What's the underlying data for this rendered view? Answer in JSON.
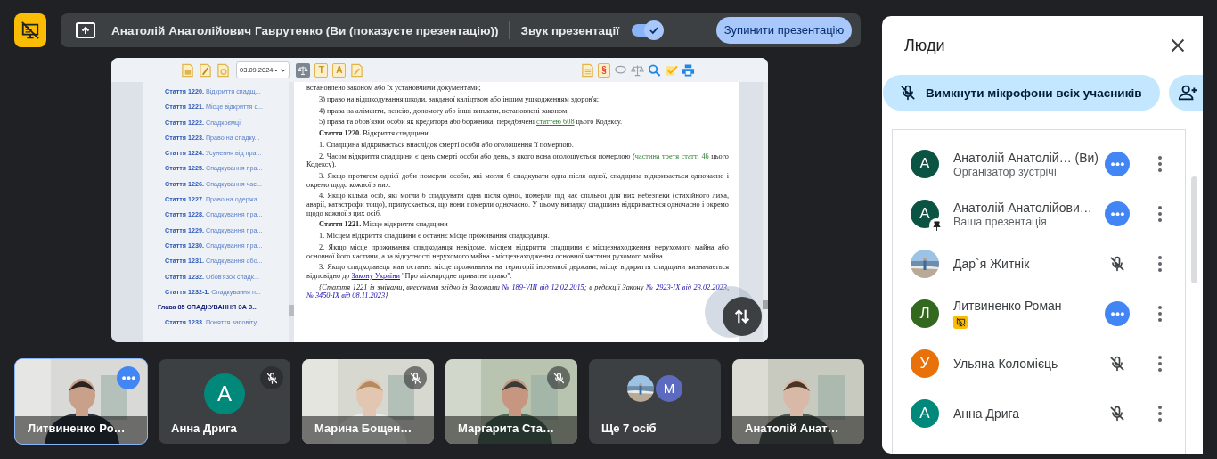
{
  "topbar": {
    "presenter": "Анатолій Анатолійович Гаврутенко (Ви (показуєте презентацію))",
    "sound": {
      "label": "Звук презентації",
      "on": true
    },
    "stop_button": "Зупинити презентацію"
  },
  "slide": {
    "toolbar": {
      "date": "03.09.2024 •",
      "letter_buttons": [
        "T",
        "A"
      ],
      "section_mark": "§"
    },
    "contents": [
      {
        "kind": "article",
        "text": "**Стаття 1220.** Відкриття спадщ..."
      },
      {
        "kind": "article",
        "text": "**Стаття 1221.** Місце відкриття с..."
      },
      {
        "kind": "article",
        "text": "**Стаття 1222.** Спадкоємці"
      },
      {
        "kind": "article",
        "text": "**Стаття 1223.** Право на спадку..."
      },
      {
        "kind": "article",
        "text": "**Стаття 1224.** Усунення від пра..."
      },
      {
        "kind": "article",
        "text": "**Стаття 1225.** Спадкування пра..."
      },
      {
        "kind": "article",
        "text": "**Стаття 1226.** Спадкування час..."
      },
      {
        "kind": "article",
        "text": "**Стаття 1227.** Право на одержа..."
      },
      {
        "kind": "article",
        "text": "**Стаття 1228.** Спадкування пра..."
      },
      {
        "kind": "article",
        "text": "**Стаття 1229.** Спадкування пра..."
      },
      {
        "kind": "article",
        "text": "**Стаття 1230.** Спадкування пра..."
      },
      {
        "kind": "article",
        "text": "**Стаття 1231.** Спадкування обо..."
      },
      {
        "kind": "article",
        "text": "**Стаття 1232.** Обов'язок спадк..."
      },
      {
        "kind": "article",
        "text": "**Стаття 1232-1.** Спадкування п..."
      },
      {
        "kind": "chapter",
        "text": "Глава 85 СПАДКУВАННЯ ЗА З..."
      },
      {
        "kind": "article",
        "text": "**Стаття 1233.** Поняття заповіту"
      }
    ],
    "paragraphs": [
      {
        "kind": "continued",
        "parts": [
          {
            "kind": "text",
            "text": "встановлено законом або їх установчими документами;"
          }
        ]
      },
      {
        "kind": "normal",
        "parts": [
          {
            "kind": "text",
            "text": "3) право на відшкодування шкоди, завданої каліцтвом або іншим ушкодженням здоров'я;"
          }
        ]
      },
      {
        "kind": "normal",
        "parts": [
          {
            "kind": "text",
            "text": "4) права на аліменти, пенсію, допомогу або інші виплати, встановлені законом;"
          }
        ]
      },
      {
        "kind": "normal",
        "parts": [
          {
            "kind": "text",
            "text": "5) права та обов'язки особи як кредитора або боржника, передбачені "
          },
          {
            "kind": "link",
            "text": "статтею 608",
            "color": "#2e7d32"
          },
          {
            "kind": "text",
            "text": " цього Кодексу."
          }
        ]
      },
      {
        "kind": "normal",
        "parts": [
          {
            "kind": "bold",
            "text": "Стаття 1220."
          },
          {
            "kind": "text",
            "text": " Відкриття спадщини"
          }
        ]
      },
      {
        "kind": "normal",
        "parts": [
          {
            "kind": "text",
            "text": "1. Спадщина відкривається внаслідок смерті особи або оголошення її померлою."
          }
        ]
      },
      {
        "kind": "normal",
        "parts": [
          {
            "kind": "text",
            "text": "2. Часом відкриття спадщини є день смерті особи або день, з якого вона оголошується померлою ("
          },
          {
            "kind": "link",
            "text": "частина третя статті 46",
            "color": "#2e7d32"
          },
          {
            "kind": "text",
            "text": " цього Кодексу)."
          }
        ]
      },
      {
        "kind": "normal",
        "parts": [
          {
            "kind": "text",
            "text": "3. Якщо протягом однієї доби померли особи, які могли б спадкувати одна після одної, спадщина відкривається одночасно і окремо щодо кожної з них."
          }
        ]
      },
      {
        "kind": "normal",
        "parts": [
          {
            "kind": "text",
            "text": "4. Якщо кілька осіб, які могли б спадкувати одна після одної, померли під час спільної для них небезпеки (стихійного лиха, аварії, катастрофи тощо), припускається, що вони померли одночасно. У цьому випадку спадщина відкривається одночасно і окремо щодо кожної з цих осіб."
          }
        ]
      },
      {
        "kind": "normal",
        "parts": [
          {
            "kind": "bold",
            "text": "Стаття 1221."
          },
          {
            "kind": "text",
            "text": " Місце відкриття спадщини"
          }
        ]
      },
      {
        "kind": "normal",
        "parts": [
          {
            "kind": "text",
            "text": "1. Місцем відкриття спадщини є останнє місце проживання спадкодавця."
          }
        ]
      },
      {
        "kind": "normal",
        "parts": [
          {
            "kind": "text",
            "text": "2. Якщо місце проживання спадкодавця невідоме, місцем відкриття спадщини є місцезнаходження нерухомого майна або основної його частини, а за відсутності нерухомого майна - місцезнаходження основної частини рухомого майна."
          }
        ]
      },
      {
        "kind": "normal",
        "parts": [
          {
            "kind": "text",
            "text": "3. Якщо спадкодавець мав останнє місце проживання на території іноземної держави, місце відкриття спадщини визначається відповідно до "
          },
          {
            "kind": "link",
            "text": "Закону України",
            "color": "#1a0dab"
          },
          {
            "kind": "text",
            "text": " \"Про міжнародне приватне право\"."
          }
        ]
      },
      {
        "kind": "note",
        "parts": [
          {
            "kind": "text",
            "text": "{Стаття 1221 із змінами, внесеними згідно із Законами "
          },
          {
            "kind": "link",
            "text": "№ 189-VIII від 12.02.2015",
            "color": "#1a0dab"
          },
          {
            "kind": "text",
            "text": "; в редакції Закону "
          },
          {
            "kind": "link",
            "text": "№ 2923-IX від 23.02.2023",
            "color": "#1a0dab"
          },
          {
            "kind": "text",
            "text": ", "
          },
          {
            "kind": "link",
            "text": "№ 3450-IX від 08.11.2023",
            "color": "#1a0dab"
          },
          {
            "kind": "text",
            "text": "}"
          }
        ]
      }
    ]
  },
  "tiles": [
    {
      "kind": "video",
      "name": "Литвиненко Ро…",
      "selected": true,
      "muted": false,
      "menu": true
    },
    {
      "kind": "avatar",
      "letter": "А",
      "color": "#00897b",
      "name": "Анна Дрига",
      "selected": false,
      "muted": true,
      "menu": false
    },
    {
      "kind": "video",
      "name": "Марина Бощен…",
      "selected": false,
      "muted": true,
      "menu": false
    },
    {
      "kind": "video",
      "name": "Маргарита Ста…",
      "selected": false,
      "muted": true,
      "menu": false
    },
    {
      "kind": "overflow",
      "letter": "М",
      "color": "#5c6bc0",
      "name": "Ще 7 осіб",
      "selected": false,
      "muted": false,
      "menu": false
    },
    {
      "kind": "video",
      "name": "Анатолій Анат…",
      "selected": false,
      "muted": false,
      "menu": false
    }
  ],
  "people": {
    "title": "Люди",
    "mute_all": "Вимкнути мікрофони всіх учасників",
    "participants": [
      {
        "name": "Анатолій Анатолій… (Ви)",
        "role": "Організатор зустрічі",
        "avatar": {
          "kind": "letter",
          "letter": "А",
          "color": "#0b5443"
        },
        "pinned": false,
        "screen_badge": false,
        "muted": false
      },
      {
        "name": "Анатолій Анатолійови…",
        "role": "Ваша презентація",
        "avatar": {
          "kind": "letter",
          "letter": "А",
          "color": "#0b5443"
        },
        "pinned": true,
        "screen_badge": false,
        "muted": false
      },
      {
        "name": "Дар`я Житнік",
        "pinned": false,
        "screen_badge": false,
        "muted": true
      },
      {
        "name": "Литвиненко Роман",
        "avatar": {
          "kind": "letter",
          "letter": "Л",
          "color": "#33691e"
        },
        "pinned": false,
        "screen_badge": true,
        "muted": false
      },
      {
        "name": "Ульяна Коломієць",
        "avatar": {
          "kind": "letter",
          "letter": "У",
          "color": "#e8710a"
        },
        "pinned": false,
        "screen_badge": false,
        "muted": true
      },
      {
        "name": "Анна Дрига",
        "avatar": {
          "kind": "letter",
          "letter": "А",
          "color": "#00897b"
        },
        "pinned": false,
        "screen_badge": false,
        "muted": true
      }
    ]
  }
}
